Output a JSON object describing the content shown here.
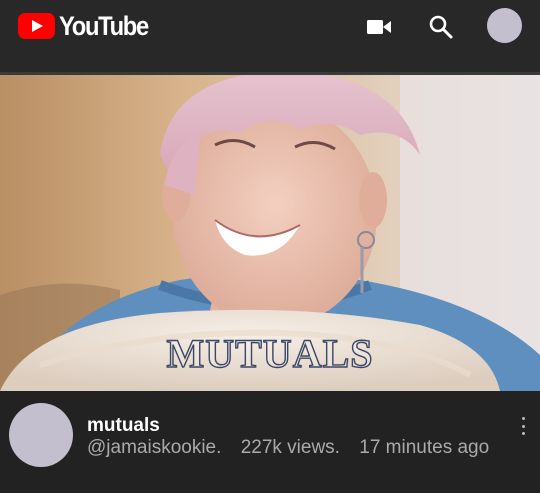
{
  "header": {
    "logo_text": "YouTube",
    "icons": [
      "video-camera-icon",
      "search-icon",
      "account-avatar"
    ]
  },
  "video": {
    "overlay_title": "MUTUALS",
    "title": "mutuals",
    "channel": "@jamaiskookie.",
    "views": "227k views.",
    "age": "17 minutes ago"
  },
  "colors": {
    "header_bg": "#282828",
    "page_bg": "#222222",
    "brand_red": "#ff0000",
    "avatar": "#c4bfcf",
    "secondary_text": "#aaaaaa"
  }
}
